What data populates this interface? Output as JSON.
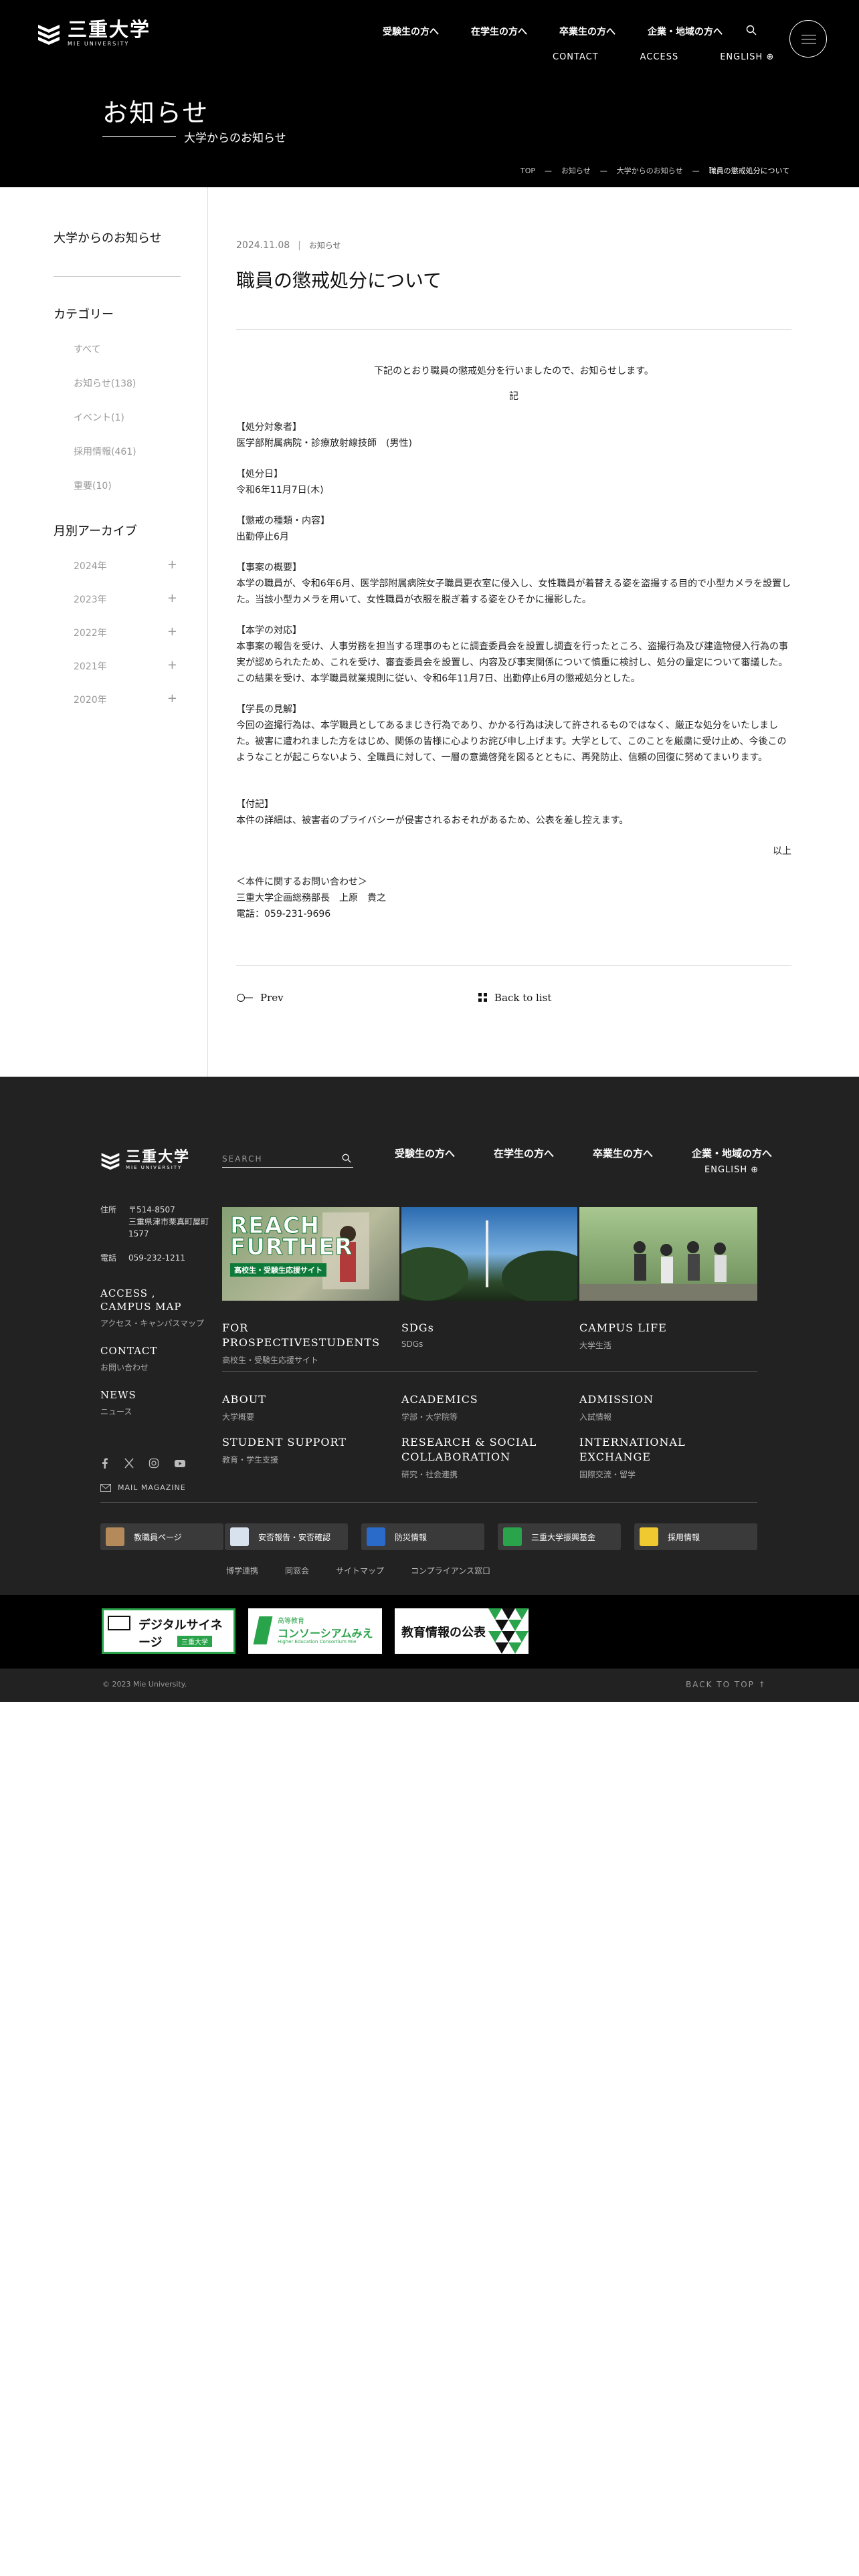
{
  "header": {
    "logo_jp": "三重大学",
    "logo_en": "MIE UNIVERSITY",
    "nav_primary": [
      "受験生の方へ",
      "在学生の方へ",
      "卒業生の方へ",
      "企業・地域の方へ"
    ],
    "nav_secondary": [
      "CONTACT",
      "ACCESS",
      "ENGLISH"
    ],
    "title": "お知らせ",
    "subtitle": "大学からのお知らせ",
    "breadcrumbs": [
      "TOP",
      "お知らせ",
      "大学からのお知らせ",
      "職員の懲戒処分について"
    ]
  },
  "sidebar": {
    "title": "大学からのお知らせ",
    "category_title": "カテゴリー",
    "categories": [
      "すべて",
      "お知らせ(138)",
      "イベント(1)",
      "採用情報(461)",
      "重要(10)"
    ],
    "archive_title": "月別アーカイブ",
    "years": [
      "2024年",
      "2023年",
      "2022年",
      "2021年",
      "2020年"
    ]
  },
  "article": {
    "date": "2024.11.08",
    "tag": "お知らせ",
    "title": "職員の懲戒処分について",
    "intro": "下記のとおり職員の懲戒処分を行いましたので、お知らせします。",
    "ki": "記",
    "s1_h": "【処分対象者】",
    "s1_b": "医学部附属病院・診療放射線技師　(男性)",
    "s2_h": "【処分日】",
    "s2_b": "令和6年11月7日(木)",
    "s3_h": "【懲戒の種類・内容】",
    "s3_b": "出勤停止6月",
    "s4_h": "【事案の概要】",
    "s4_b": "本学の職員が、令和6年6月、医学部附属病院女子職員更衣室に侵入し、女性職員が着替える姿を盗撮する目的で小型カメラを設置した。当該小型カメラを用いて、女性職員が衣服を脱ぎ着する姿をひそかに撮影した。",
    "s5_h": "【本学の対応】",
    "s5_b": "本事案の報告を受け、人事労務を担当する理事のもとに調査委員会を設置し調査を行ったところ、盗撮行為及び建造物侵入行為の事実が認められたため、これを受け、審査委員会を設置し、内容及び事実関係について慎重に検討し、処分の量定について審議した。この結果を受け、本学職員就業規則に従い、令和6年11月7日、出勤停止6月の懲戒処分とした。",
    "s6_h": "【学長の見解】",
    "s6_b": "今回の盗撮行為は、本学職員としてあるまじき行為であり、かかる行為は決して許されるものではなく、厳正な処分をいたしました。被害に遭われました方をはじめ、関係の皆様に心よりお詫び申し上げます。大学として、このことを厳粛に受け止め、今後このようなことが起こらないよう、全職員に対して、一層の意識啓発を図るとともに、再発防止、信頼の回復に努めてまいります。",
    "s7_h": "【付記】",
    "s7_b": "本件の詳細は、被害者のプライバシーが侵害されるおそれがあるため、公表を差し控えます。",
    "ijo": "以上",
    "contact_h": "＜本件に関するお問い合わせ＞",
    "contact_1": "三重大学企画総務部長　上原　貴之",
    "contact_2": "電話：059-231-9696",
    "prev": "Prev",
    "back": "Back to list"
  },
  "footer": {
    "logo_jp": "三重大学",
    "logo_en": "MIE UNIVERSITY",
    "search_placeholder": "SEARCH",
    "nav": [
      "受験生の方へ",
      "在学生の方へ",
      "卒業生の方へ",
      "企業・地域の方へ"
    ],
    "english": "ENGLISH",
    "addr_label": "住所",
    "addr_value_1": "〒514-8507",
    "addr_value_2": "三重県津市栗真町屋町",
    "addr_value_3": "1577",
    "tel_label": "電話",
    "tel_value": "059-232-1211",
    "links": [
      {
        "h": "ACCESS , CAMPUS MAP",
        "s": "アクセス・キャンパスマップ"
      },
      {
        "h": "CONTACT",
        "s": "お問い合わせ"
      },
      {
        "h": "NEWS",
        "s": "ニュース"
      }
    ],
    "banner_text_1": "REACH",
    "banner_text_2": "FURTHER",
    "banner_text_3": "高校生・受験生応援サイト",
    "banner_caps": [
      {
        "h": "FOR PROSPECTIVESTUDENTS",
        "s": "高校生・受験生応援サイト"
      },
      {
        "h": "SDGs",
        "s": "SDGs"
      },
      {
        "h": "CAMPUS LIFE",
        "s": "大学生活"
      }
    ],
    "cols": [
      {
        "h": "ABOUT",
        "s": "大学概要"
      },
      {
        "h": "ACADEMICS",
        "s": "学部・大学院等"
      },
      {
        "h": "ADMISSION",
        "s": "入試情報"
      },
      {
        "h": "STUDENT SUPPORT",
        "s": "教育・学生支援"
      },
      {
        "h": "RESEARCH & SOCIAL COLLABORATION",
        "s": "研究・社会連携"
      },
      {
        "h": "INTERNATIONAL EXCHANGE",
        "s": "国際交流・留学"
      }
    ],
    "mail_magazine": "MAIL MAGAZINE",
    "quick": [
      "教職員ページ",
      "安否報告・安否確認",
      "防災情報",
      "三重大学振興基金",
      "採用情報"
    ],
    "small": [
      "博学連携",
      "同窓会",
      "サイトマップ",
      "コンプライアンス窓口"
    ],
    "logo1_a": "デジタルサイネージ",
    "logo1_b": "三重大学",
    "logo2_a": "高等教育",
    "logo2_b": "コンソーシアムみえ",
    "logo2_c": "Higher Education Consortium Mie",
    "logo3": "教育情報の公表",
    "copyright": "© 2023 Mie University.",
    "back_to_top": "BACK TO TOP"
  },
  "colors": {
    "black": "#000000",
    "footer": "#222222",
    "accent_green": "#2aa44b"
  }
}
